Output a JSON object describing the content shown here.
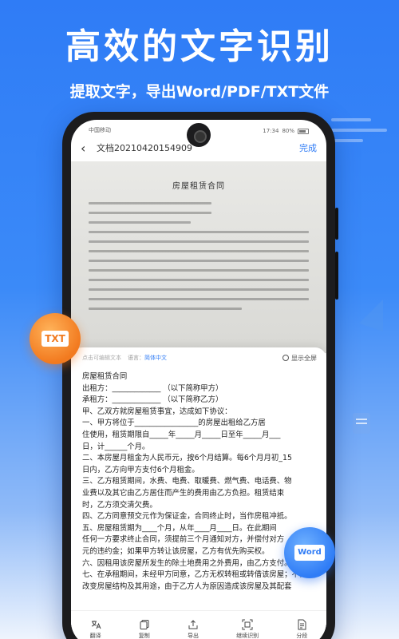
{
  "hero": {
    "title": "高效的文字识别",
    "subtitle": "提取文字，导出Word/PDF/TXT文件"
  },
  "status_bar": {
    "carrier": "中国移动",
    "time": "17:34",
    "battery": "80%"
  },
  "nav": {
    "title": "文档20210420154909",
    "done_label": "完成"
  },
  "scan": {
    "title": "房屋租赁合同"
  },
  "panel": {
    "hint": "点击可编辑文本",
    "language_label": "语言：",
    "language_value": "简体中文",
    "fullscreen_label": "显示全屏",
    "lines": [
      "房屋租赁合同",
      "出租方：_____________ （以下简称甲方）",
      "承租方：_____________ （以下简称乙方）",
      "甲、乙双方就房屋租赁事宜，达成如下协议：",
      "一、甲方将位于_________________的房屋出租给乙方居",
      "住使用，租赁期限自_____年_____月_____日至年_____月___",
      "日，计______个月。",
      "二、本房屋月租金为人民币元，按6个月结算。每6个月月初_15",
      "日内，乙方向甲方支付6个月租金。",
      "三、乙方租赁期间，水费、电费、取暖费、燃气费、电话费、物",
      "业费以及其它由乙方居住而产生的费用由乙方负担。租赁结束",
      "时，乙方须交清欠费。",
      "四、乙方同意预交元作为保证金，合同终止时，当作房租冲抵。",
      "五、房屋租赁期为____个月，从年____月____日。在此期间",
      "任何一方要求终止合同，须提前三个月通知对方，并偿付对方",
      "元的违约金；如果甲方转让该房屋，乙方有优先购买权。",
      "六、因租用该房屋所发生的除土地费用之外费用，由乙方支付。",
      "七、在承租期间，未经甲方同意，乙方无权转租或转借该房屋；不得",
      "改变房屋结构及其用途，由于乙方人为原因造成该房屋及其配套"
    ]
  },
  "toolbar": {
    "items": [
      {
        "label": "翻译",
        "icon": "translate-icon"
      },
      {
        "label": "复制",
        "icon": "copy-icon"
      },
      {
        "label": "导出",
        "icon": "export-icon"
      },
      {
        "label": "继续识别",
        "icon": "scan-icon"
      },
      {
        "label": "分段",
        "icon": "paragraph-icon"
      }
    ]
  },
  "badges": {
    "txt": "TXT",
    "word": "Word"
  },
  "colors": {
    "accent": "#2f7cf6",
    "txt_badge": "#f27a1f"
  }
}
